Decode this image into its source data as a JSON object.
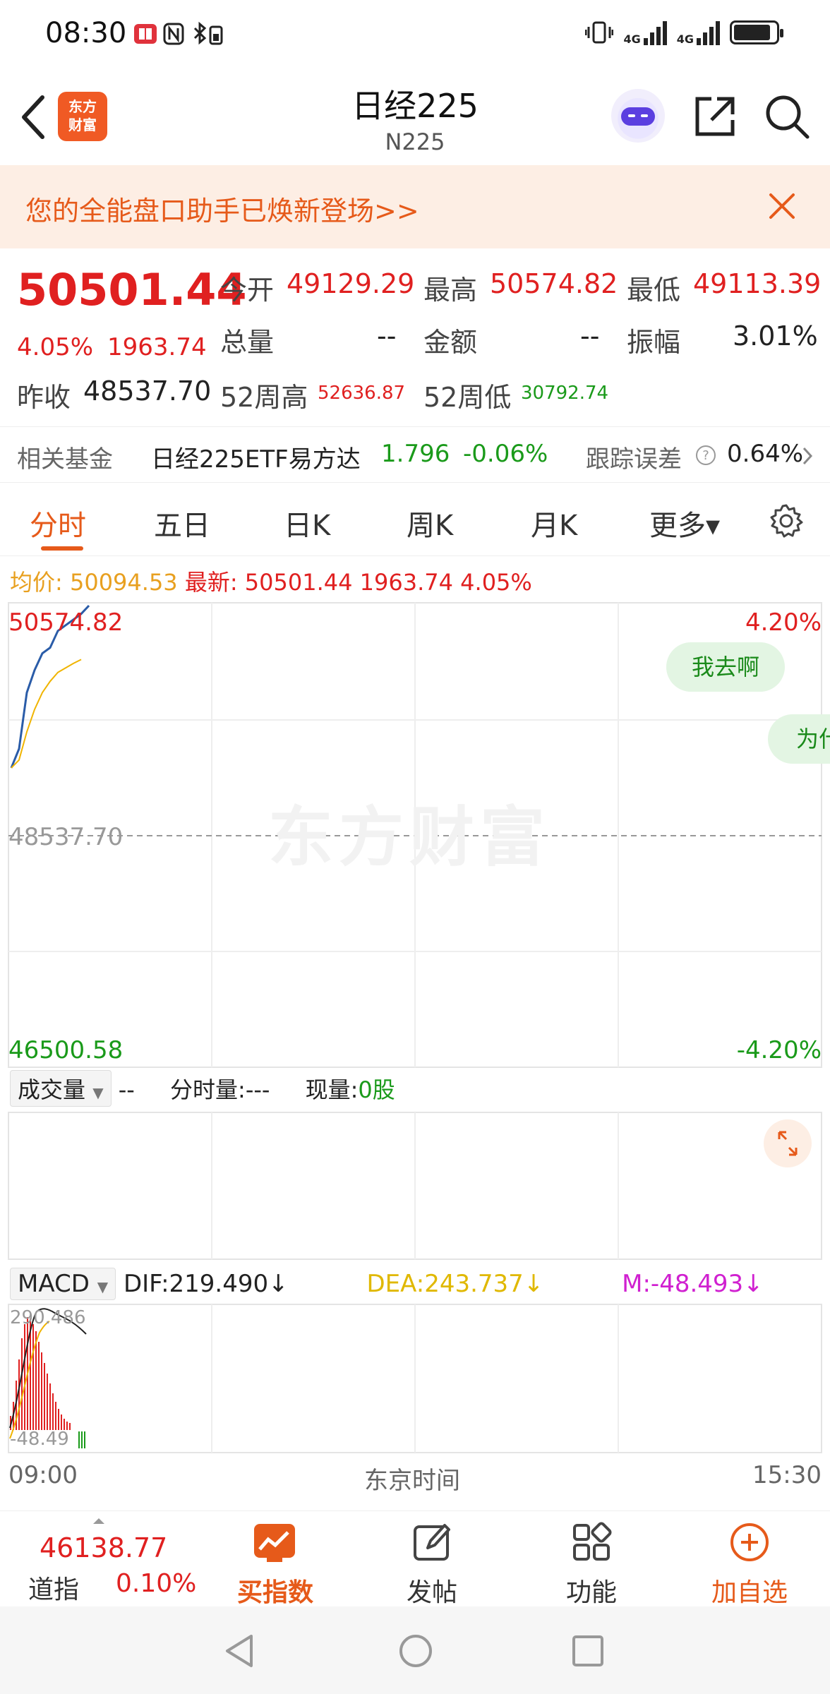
{
  "status_bar": {
    "time": "08:30",
    "network_1": "4G",
    "network_2": "4G"
  },
  "header": {
    "back_icon": "chevron-left-icon",
    "logo_text_line1": "东方",
    "logo_text_line2": "财富",
    "title": "日经225",
    "subtitle": "N225",
    "share_icon": "share-icon",
    "search_icon": "search-icon"
  },
  "banner": {
    "text": "您的全能盘口助手已焕新登场>>",
    "close_icon": "close-icon"
  },
  "quote": {
    "price": "50501.44",
    "change_pct": "4.05%",
    "change_val": "1963.74",
    "open_label": "今开",
    "open_val": "49129.29",
    "high_label": "最高",
    "high_val": "50574.82",
    "low_label": "最低",
    "low_val": "49113.39",
    "volume_label": "总量",
    "volume_val": "--",
    "amount_label": "金额",
    "amount_val": "--",
    "amplitude_label": "振幅",
    "amplitude_val": "3.01%",
    "prev_close_label": "昨收",
    "prev_close_val": "48537.70",
    "week52_high_label": "52周高",
    "week52_high_val": "52636.87",
    "week52_low_label": "52周低",
    "week52_low_val": "30792.74"
  },
  "fund": {
    "label": "相关基金",
    "name": "日经225ETF易方达",
    "price": "1.796",
    "change": "-0.06%",
    "tracking_label": "跟踪误差",
    "tracking_val": "0.64%"
  },
  "tabs": [
    {
      "label": "分时",
      "active": true
    },
    {
      "label": "五日"
    },
    {
      "label": "日K"
    },
    {
      "label": "周K"
    },
    {
      "label": "月K"
    },
    {
      "label": "更多▾"
    }
  ],
  "chart_info": {
    "avg_label": "均价:",
    "avg_val": "50094.53",
    "latest_label": "最新:",
    "latest_val": "50501.44",
    "latest_change": "1963.74",
    "latest_pct": "4.05%"
  },
  "chart_data": {
    "type": "line",
    "price_high_label": "50574.82",
    "price_mid_label": "48537.70",
    "price_low_label": "46500.58",
    "pct_high_label": "4.20%",
    "pct_low_label": "-4.20%",
    "watermark": "东方财富",
    "bubble_1": "我去啊",
    "bubble_2": "为什",
    "ylim": [
      46500.58,
      50574.82
    ],
    "series": [
      {
        "name": "price",
        "color": "#2a5ca8",
        "values": [
          49129.29,
          49300,
          49800,
          50000,
          50150,
          50200,
          50350,
          50400,
          50450,
          50501.44,
          50574.82
        ]
      },
      {
        "name": "avg",
        "color": "#f0b400",
        "values": [
          49129.29,
          49200,
          49450,
          49650,
          49800,
          49900,
          49980,
          50020,
          50060,
          50094.53
        ]
      }
    ],
    "x_start": "09:00",
    "x_mid": "东京时间",
    "x_end": "15:30"
  },
  "volume": {
    "dropdown_label": "成交量",
    "dash": "--",
    "tick_label": "分时量:",
    "tick_val": "---",
    "current_label": "现量:",
    "current_val": "0股"
  },
  "macd": {
    "dropdown_label": "MACD",
    "dif": "DIF:219.490",
    "dea": "DEA:243.737",
    "m": "M:-48.493",
    "arrow": "↓",
    "top_label": "290.486",
    "bottom_label": "-48.49"
  },
  "bottom_nav": {
    "dow_value": "46138.77",
    "dow_label": "道指",
    "dow_pct": "0.10%",
    "buy_index": "买指数",
    "post": "发帖",
    "functions": "功能",
    "add_watch": "加自选"
  },
  "colors": {
    "up": "#e02020",
    "down": "#1a9a1a",
    "accent": "#e65a1a",
    "price_line": "#2a5ca8",
    "avg_line": "#f0b400"
  }
}
